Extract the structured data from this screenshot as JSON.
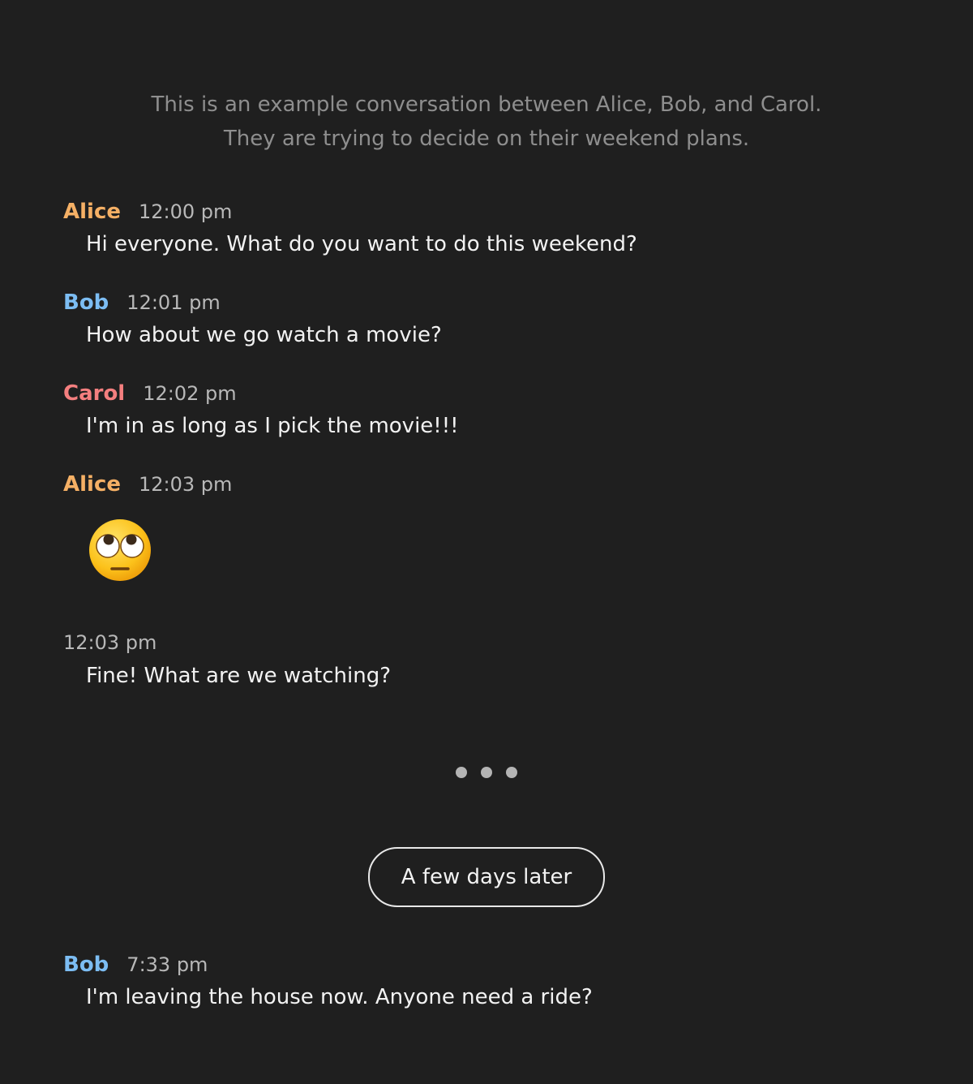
{
  "intro": {
    "line1": "This is an example conversation between Alice, Bob, and Carol.",
    "line2": "They are trying to decide on their weekend plans."
  },
  "colors": {
    "background": "#1f1f1f",
    "alice": "#f5b065",
    "bob": "#7cbdf3",
    "carol": "#f47f7f",
    "intro_text": "#8e8e8e",
    "timestamp": "#b8b8b8",
    "message_text": "#f2f2f2"
  },
  "messages": [
    {
      "sender": "Alice",
      "time": "12:00 pm",
      "text": "Hi everyone. What do you want to do this weekend?"
    },
    {
      "sender": "Bob",
      "time": "12:01 pm",
      "text": "How about we go watch a movie?"
    },
    {
      "sender": "Carol",
      "time": "12:02 pm",
      "text": "I'm in as long as I pick the movie!!!"
    },
    {
      "sender": "Alice",
      "time": "12:03 pm",
      "emoji": "face-with-rolling-eyes-icon"
    },
    {
      "sender": "",
      "time": "12:03 pm",
      "text": "Fine! What are we watching?"
    },
    {
      "sender": "Bob",
      "time": "7:33 pm",
      "text": "I'm leaving the house now. Anyone need a ride?"
    }
  ],
  "ellipsis": {
    "icon": "ellipsis-dots-icon"
  },
  "divider": {
    "label": "A few days later"
  }
}
